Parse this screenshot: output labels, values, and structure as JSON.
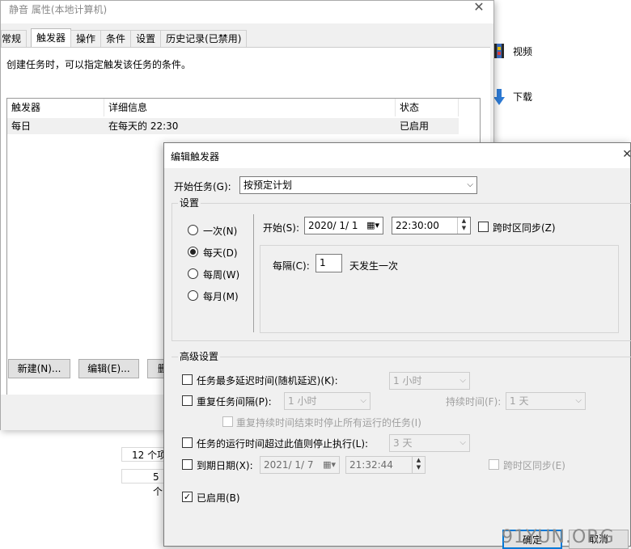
{
  "explorer": {
    "items": [
      {
        "label": "视频",
        "icon": "film-icon"
      },
      {
        "label": "下载",
        "icon": "download-arrow-icon"
      }
    ],
    "strip_1": "12 个项",
    "strip_2": "5 个"
  },
  "props": {
    "title": "静音 属性(本地计算机)",
    "tabs": [
      "常规",
      "触发器",
      "操作",
      "条件",
      "设置",
      "历史记录(已禁用)"
    ],
    "description": "创建任务时，可以指定触发该任务的条件。",
    "columns": [
      "触发器",
      "详细信息",
      "状态"
    ],
    "rows": [
      {
        "trigger": "每日",
        "detail": "在每天的 22:30",
        "status": "已启用"
      }
    ],
    "buttons": {
      "new": "新建(N)...",
      "edit": "编辑(E)...",
      "delete": "删"
    }
  },
  "dialog": {
    "title": "编辑触发器",
    "begin_label": "开始任务(G):",
    "begin_value": "按预定计划",
    "settings_label": "设置",
    "radios": [
      {
        "label": "一次(N)",
        "checked": false
      },
      {
        "label": "每天(D)",
        "checked": true
      },
      {
        "label": "每周(W)",
        "checked": false
      },
      {
        "label": "每月(M)",
        "checked": false
      }
    ],
    "start_label": "开始(S):",
    "start_date": "2020/  1/  1",
    "start_time": "22:30:00",
    "sync_tz_label": "跨时区同步(Z)",
    "every_label": "每隔(C):",
    "every_value": "1",
    "every_suffix": "天发生一次",
    "advanced_label": "高级设置",
    "delay_label": "任务最多延迟时间(随机延迟)(K):",
    "delay_value": "1 小时",
    "repeat_label": "重复任务间隔(P):",
    "repeat_value": "1 小时",
    "duration_label": "持续时间(F):",
    "duration_value": "1 天",
    "stop_repeat_label": "重复持续时间结束时停止所有运行的任务(I)",
    "stop_longer_label": "任务的运行时间超过此值则停止执行(L):",
    "stop_longer_value": "3 天",
    "expire_label": "到期日期(X):",
    "expire_date": "2021/  1/  7",
    "expire_time": "21:32:44",
    "expire_sync_label": "跨时区同步(E)",
    "enabled_label": "已启用(B)",
    "ok_label": "确定",
    "cancel_label": "取消"
  },
  "watermark": "91YUN.ORG"
}
